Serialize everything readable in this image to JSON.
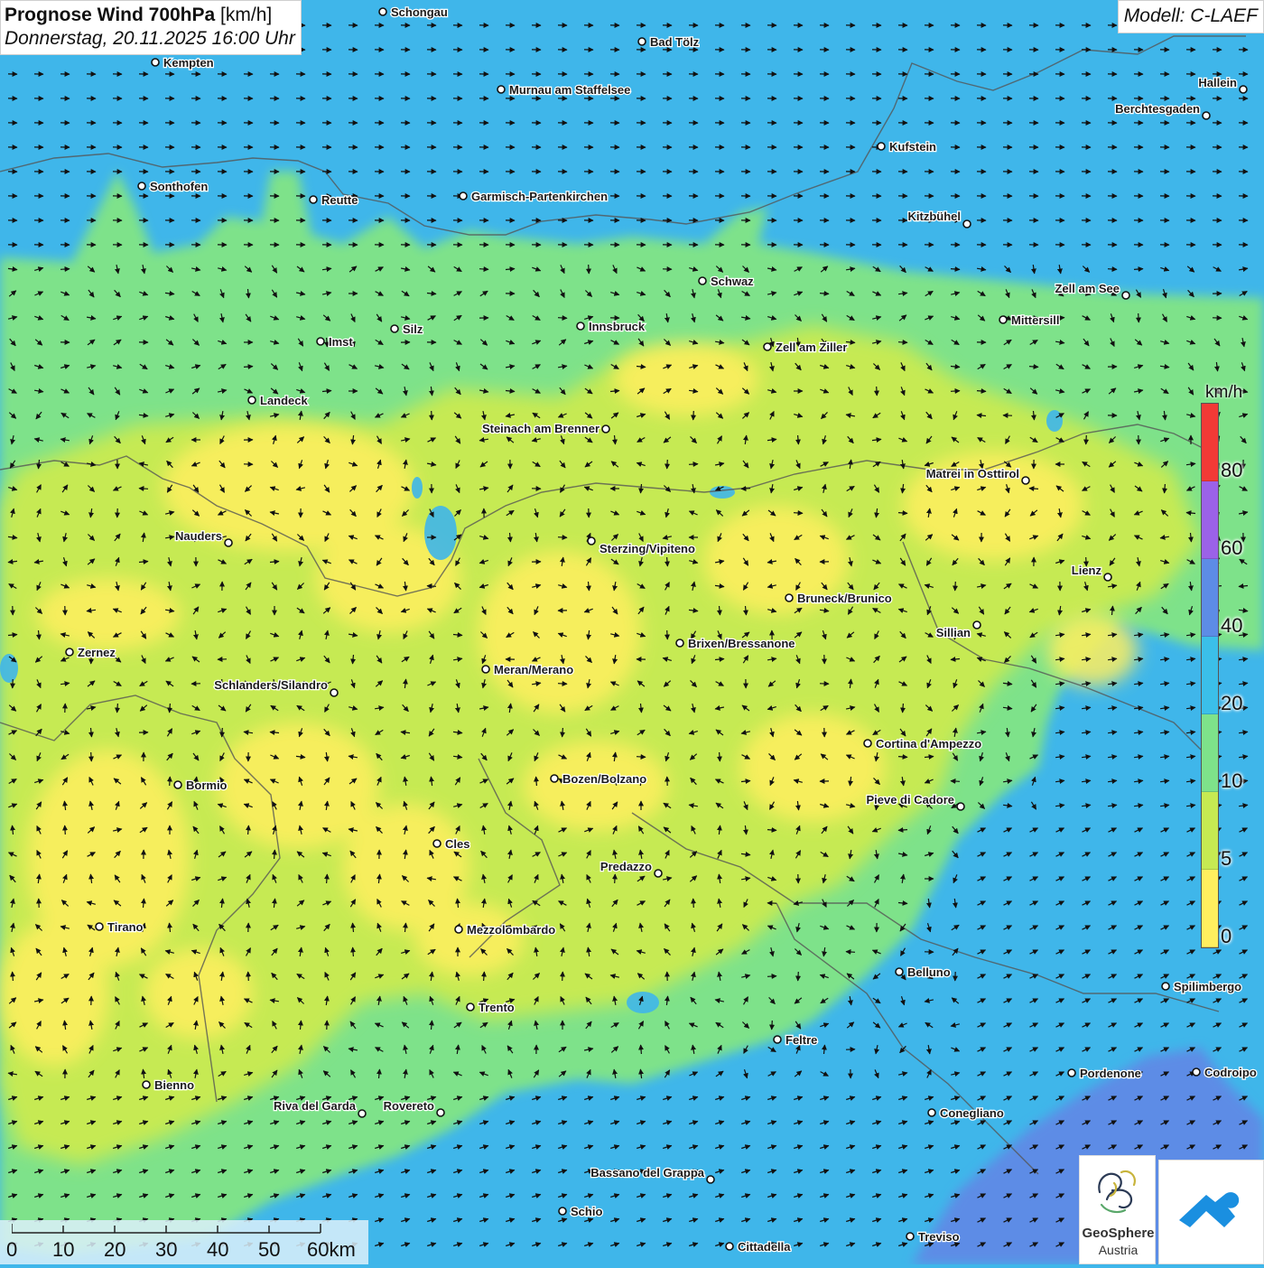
{
  "header": {
    "title": "Prognose Wind 700hPa",
    "unit": "[km/h]",
    "subtitle": "Donnerstag, 20.11.2025 16:00 Uhr"
  },
  "model": {
    "label": "Modell: C-LAEF"
  },
  "legend": {
    "unit": "km/h",
    "labels": [
      "80",
      "60",
      "40",
      "20",
      "10",
      "5",
      "0"
    ],
    "colors": [
      "#f23a36",
      "#9b62e8",
      "#5d8ce6",
      "#3bbfe9",
      "#7ee28a",
      "#c6ea52",
      "#ffef5e"
    ]
  },
  "scalebar": {
    "labels": [
      "0",
      "10",
      "20",
      "30",
      "40",
      "50",
      "60km"
    ]
  },
  "logos": {
    "geosphere_line1": "GeoSphere",
    "geosphere_line2": "Austria",
    "geosphere_icon": "geosphere-logo-icon",
    "app_icon": "cloud-arrow-app-icon"
  },
  "map": {
    "colors": {
      "wind_0_5": "#ffef5e",
      "wind_5_10": "#c6ea52",
      "wind_10_20": "#7ee28a",
      "wind_20_40": "#3bbfe9",
      "wind_40_60": "#5d8ce6"
    },
    "cities": [
      "Schongau",
      "Bad Tölz",
      "Kempten",
      "Murnau am Staffelsee",
      "Hallein",
      "Berchtesgaden",
      "Kufstein",
      "Sonthofen",
      "Reutte",
      "Garmisch-Partenkirchen",
      "Kitzbühel",
      "Schwaz",
      "Zell am See",
      "Mittersill",
      "Innsbruck",
      "Silz",
      "Imst",
      "Zell am Ziller",
      "Landeck",
      "Steinach am Brenner",
      "Matrei in Osttirol",
      "Nauders",
      "Sterzing/Vipiteno",
      "Lienz",
      "Bruneck/Brunico",
      "Sillian",
      "Zernez",
      "Brixen/Bressanone",
      "Meran/Merano",
      "Schlanders/Silandro",
      "Cortina d'Ampezzo",
      "Bormio",
      "Bozen/Bolzano",
      "Pieve di Cadore",
      "Cles",
      "Predazzo",
      "Tirano",
      "Mezzolombardo",
      "Belluno",
      "Spilimbergo",
      "Trento",
      "Feltre",
      "Pordenone",
      "Codroipo",
      "Bienno",
      "Riva del Garda",
      "Rovereto",
      "Conegliano",
      "Bassano del Grappa",
      "Schio",
      "Treviso",
      "Cittadella"
    ]
  }
}
